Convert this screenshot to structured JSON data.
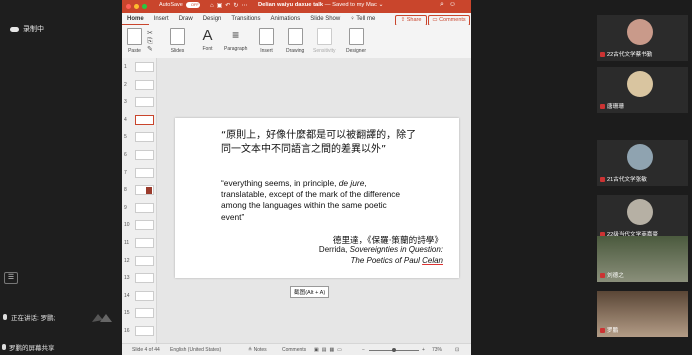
{
  "meeting": {
    "recording_label": "录制中",
    "speaking_label": "正在讲话: 罗鹏;",
    "screen_share_label": "罗鹏的屏幕共享"
  },
  "powerpoint": {
    "autosave_label": "AutoSave",
    "autosave_state": "OFF",
    "document_title_bold": "Delian waiyu daxue talk",
    "document_title_rest": " — Saved to my Mac ⌄",
    "tabs": [
      "Home",
      "Insert",
      "Draw",
      "Design",
      "Transitions",
      "Animations",
      "Slide Show",
      "♀ Tell me"
    ],
    "share_label": "Share",
    "comments_label": "Comments",
    "ribbon": {
      "paste": "Paste",
      "slides": "Slides",
      "font": "Font",
      "paragraph": "Paragraph",
      "insert": "Insert",
      "drawing": "Drawing",
      "sensitivity": "Sensitivity",
      "designer": "Designer"
    },
    "thumbnail_numbers": [
      "1",
      "2",
      "3",
      "4",
      "5",
      "6",
      "7",
      "8",
      "9",
      "10",
      "11",
      "12",
      "13",
      "14",
      "15",
      "16"
    ],
    "selected_slide": 4,
    "slide": {
      "zh_quote": "“原則上，好像什麼都是可以被翻譯的，除了同一文本中不同語言之間的差異以外”",
      "en_quote_1": "“everything seems, in principle, ",
      "en_quote_em": "de jure",
      "en_quote_2": ", translatable, except of the mark of the difference among the languages within the same poetic event”",
      "source_zh": "德里達，《保羅·策蘭的詩學》",
      "source_author": "Derrida, ",
      "source_title_1": "Sovereignties in Question:",
      "source_title_2": "The Poetics of Paul ",
      "source_title_3": "Celan"
    },
    "tooltip": "截图(Alt + A)",
    "status": {
      "slide_indicator": "Slide 4 of 44",
      "language": "English (United States)",
      "notes": "≜ Notes",
      "comments": "Comments",
      "zoom": "73%"
    }
  },
  "participants": [
    {
      "name": "22古代文学蔡书勤",
      "avatar_color": "#c99a8a"
    },
    {
      "name": "唐珊珊",
      "avatar_color": "#d9c5a0"
    },
    {
      "name": "21古代文学张敏",
      "avatar_color": "#8fa3b0"
    },
    {
      "name": "22级当代文学商嘉豪",
      "avatar_color": "#b6b0a4"
    },
    {
      "name": "刘德之",
      "avatar_color": "#5a6b4a"
    },
    {
      "name": "罗鹏",
      "avatar_color": "#7a5a48"
    }
  ]
}
